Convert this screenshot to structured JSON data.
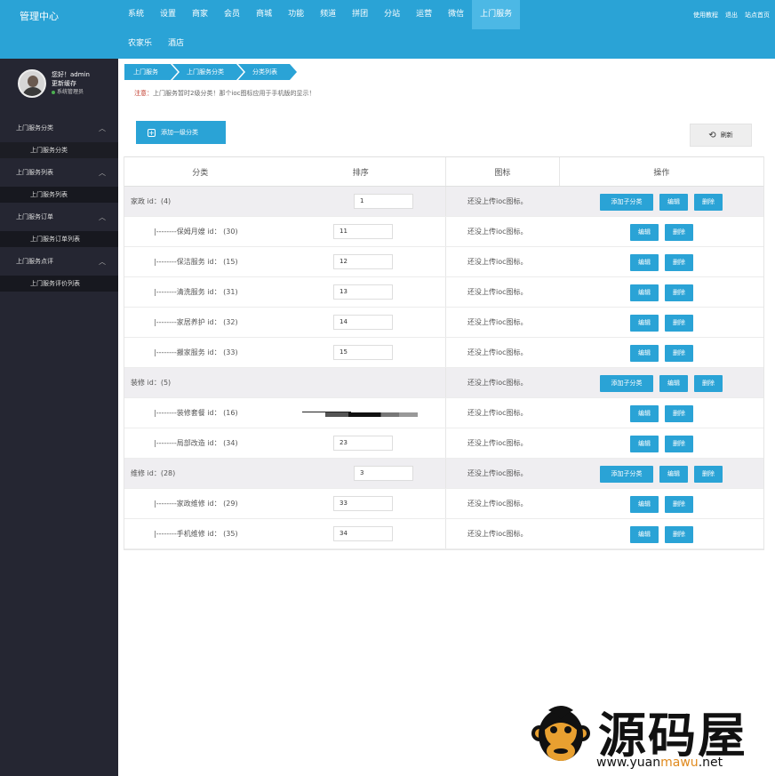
{
  "header": {
    "brand": "管理中心",
    "nav_row1": [
      "系统",
      "设置",
      "商家",
      "会员",
      "商城",
      "功能",
      "频道",
      "拼团",
      "分站",
      "运营",
      "微信",
      "上门服务"
    ],
    "nav_row2": [
      "农家乐",
      "酒店"
    ],
    "active_nav": "上门服务",
    "top_links": [
      "使用教程",
      "退出",
      "站点首页"
    ]
  },
  "user": {
    "greeting": "您好！admin",
    "cache": "更新缓存",
    "role": "系统管理员"
  },
  "sidebar": [
    {
      "head": "上门服务分类",
      "sub": "上门服务分类",
      "chevron": "︿"
    },
    {
      "head": "上门服务列表",
      "sub": "上门服务列表",
      "chevron": "︿"
    },
    {
      "head": "上门服务订单",
      "sub": "上门服务订单列表",
      "chevron": "︿"
    },
    {
      "head": "上门服务点评",
      "sub": "上门服务评价列表",
      "chevron": "︿"
    }
  ],
  "breadcrumb": [
    "上门服务",
    "上门服务分类",
    "分类列表"
  ],
  "notice": {
    "label": "注意：",
    "text": "上门服务暂时2级分类！那个ioc图标应用于手机版的显示！"
  },
  "buttons": {
    "add_top": "添加一级分类",
    "refresh": "刷新",
    "add_child": "添加子分类",
    "edit": "编辑",
    "delete": "删除"
  },
  "table": {
    "headers": [
      "分类",
      "排序",
      "图标",
      "操作"
    ],
    "rows": [
      {
        "type": "parent",
        "name": "家政 id：(4)",
        "sort": "1",
        "icon": "还没上传ioc图标。"
      },
      {
        "type": "child",
        "name": "|--------保姆月嫂 id： (30)",
        "sort": "11",
        "icon": "还没上传ioc图标。"
      },
      {
        "type": "child",
        "name": "|--------保洁服务 id： (15)",
        "sort": "12",
        "icon": "还没上传ioc图标。"
      },
      {
        "type": "child",
        "name": "|--------清洗服务 id： (31)",
        "sort": "13",
        "icon": "还没上传ioc图标。"
      },
      {
        "type": "child",
        "name": "|--------家居养护 id： (32)",
        "sort": "14",
        "icon": "还没上传ioc图标。"
      },
      {
        "type": "child",
        "name": "|--------搬家服务 id： (33)",
        "sort": "15",
        "icon": "还没上传ioc图标。"
      },
      {
        "type": "parent",
        "name": "装修 id：(5)",
        "sort": "",
        "icon": "还没上传ioc图标。"
      },
      {
        "type": "child",
        "name": "|--------装修套餐 id： (16)",
        "sort": "",
        "icon": "还没上传ioc图标。"
      },
      {
        "type": "child",
        "name": "|--------局部改造 id： (34)",
        "sort": "23",
        "icon": "还没上传ioc图标。"
      },
      {
        "type": "parent",
        "name": "维修 id：(28)",
        "sort": "3",
        "icon": "还没上传ioc图标。"
      },
      {
        "type": "child",
        "name": "|--------家政维修 id： (29)",
        "sort": "33",
        "icon": "还没上传ioc图标。"
      },
      {
        "type": "child",
        "name": "|--------手机维修 id： (35)",
        "sort": "34",
        "icon": "还没上传ioc图标。"
      }
    ]
  },
  "watermark": {
    "title": "源码屋",
    "url_pre": "www.yuan",
    "url_hl": "mawu",
    "url_post": ".net"
  }
}
